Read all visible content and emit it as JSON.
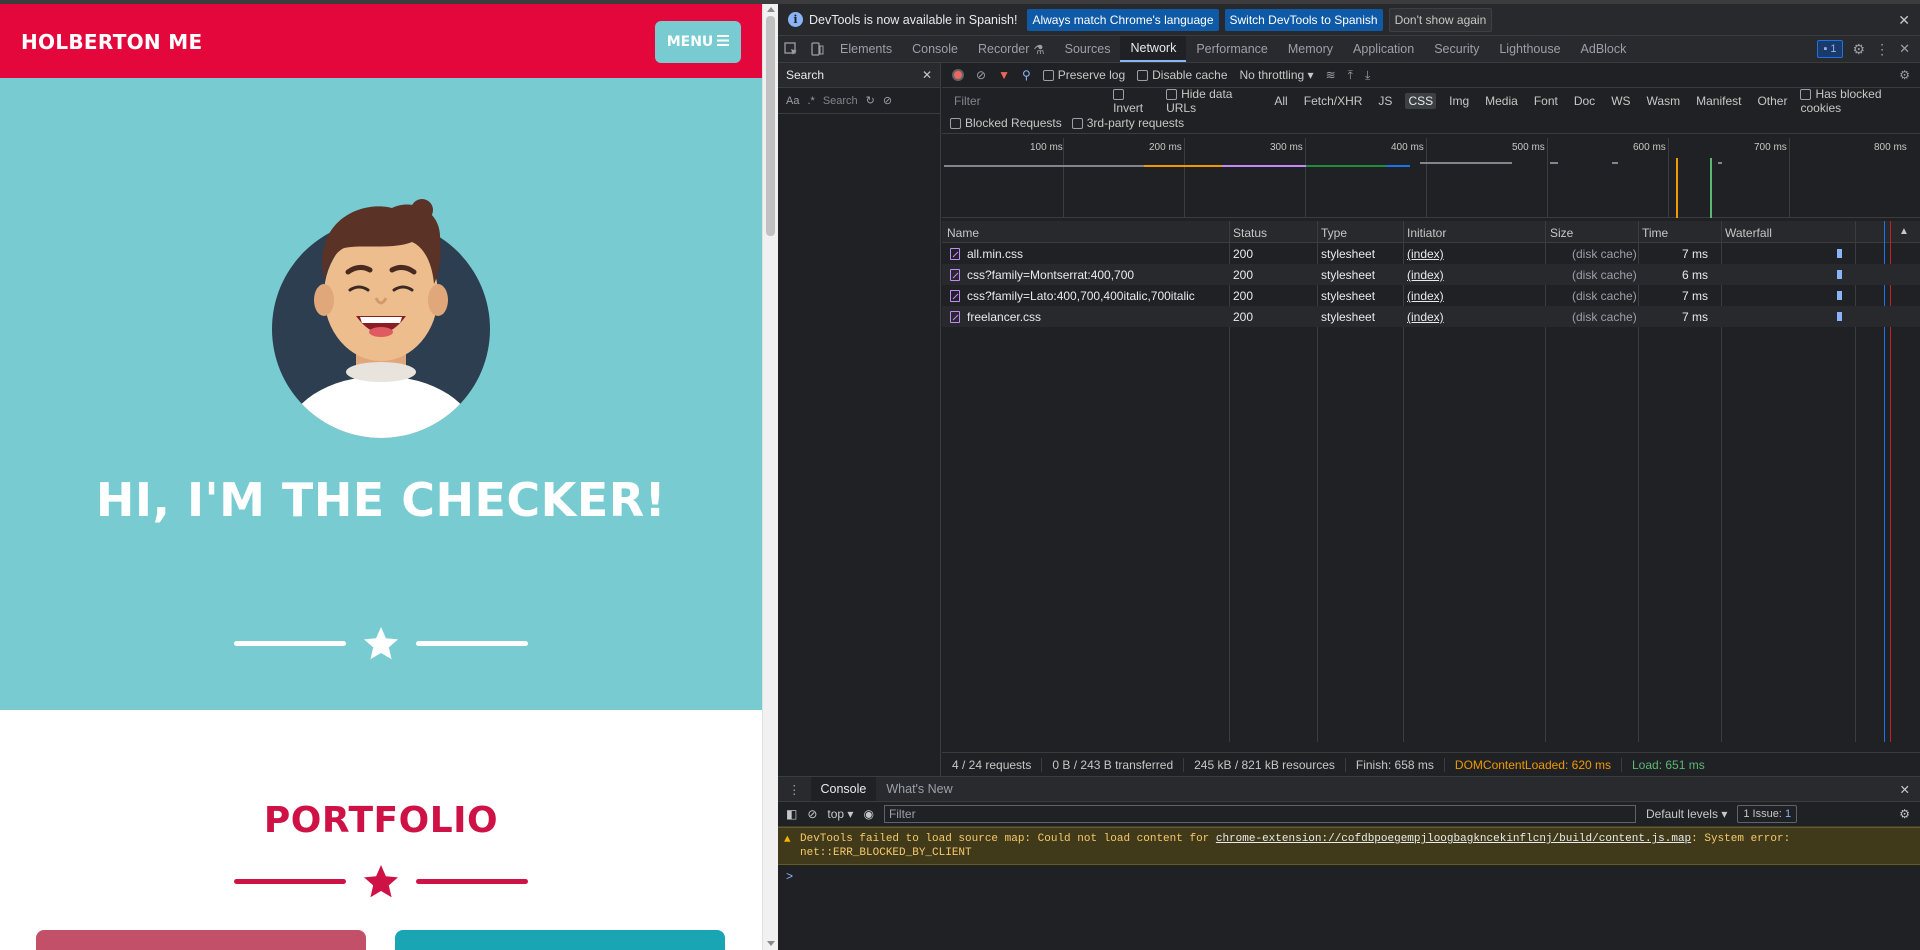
{
  "page": {
    "brand": "HOLBERTON ME",
    "menu_label": "MENU",
    "hero_title": "HI, I'M THE CHECKER!",
    "portfolio_title": "PORTFOLIO",
    "colors": {
      "navbar": "#e3073c",
      "hero": "#78ccd1",
      "accent": "#cf1246",
      "menu_button": "#77cbd1"
    }
  },
  "devtools": {
    "infobar": {
      "message": "DevTools is now available in Spanish!",
      "btn_match": "Always match Chrome's language",
      "btn_switch": "Switch DevTools to Spanish",
      "btn_dismiss": "Don't show again"
    },
    "tabs": [
      "Elements",
      "Console",
      "Recorder",
      "Sources",
      "Network",
      "Performance",
      "Memory",
      "Application",
      "Security",
      "Lighthouse",
      "AdBlock"
    ],
    "active_tab": "Network",
    "issues_count": "1",
    "search_panel": {
      "title": "Search",
      "placeholder": "Search",
      "case_label": "Aa",
      "regex_label": ".*"
    },
    "toolbar": {
      "preserve_log": "Preserve log",
      "disable_cache": "Disable cache",
      "throttling": "No throttling"
    },
    "filter": {
      "placeholder": "Filter",
      "invert": "Invert",
      "hide_data_urls": "Hide data URLs",
      "types": [
        "All",
        "Fetch/XHR",
        "JS",
        "CSS",
        "Img",
        "Media",
        "Font",
        "Doc",
        "WS",
        "Wasm",
        "Manifest",
        "Other"
      ],
      "active_type": "CSS",
      "has_blocked_cookies": "Has blocked cookies",
      "blocked_requests": "Blocked Requests",
      "third_party": "3rd-party requests"
    },
    "timeline_ticks": [
      "100 ms",
      "200 ms",
      "300 ms",
      "400 ms",
      "500 ms",
      "600 ms",
      "700 ms",
      "800 ms"
    ],
    "columns": [
      "Name",
      "Status",
      "Type",
      "Initiator",
      "Size",
      "Time",
      "Waterfall"
    ],
    "requests": [
      {
        "name": "all.min.css",
        "status": "200",
        "type": "stylesheet",
        "initiator": "(index)",
        "size": "(disk cache)",
        "time": "7 ms"
      },
      {
        "name": "css?family=Montserrat:400,700",
        "status": "200",
        "type": "stylesheet",
        "initiator": "(index)",
        "size": "(disk cache)",
        "time": "6 ms"
      },
      {
        "name": "css?family=Lato:400,700,400italic,700italic",
        "status": "200",
        "type": "stylesheet",
        "initiator": "(index)",
        "size": "(disk cache)",
        "time": "7 ms"
      },
      {
        "name": "freelancer.css",
        "status": "200",
        "type": "stylesheet",
        "initiator": "(index)",
        "size": "(disk cache)",
        "time": "7 ms"
      }
    ],
    "summary": {
      "requests": "4 / 24 requests",
      "transferred": "0 B / 243 B transferred",
      "resources": "245 kB / 821 kB resources",
      "finish": "Finish: 658 ms",
      "dcl": "DOMContentLoaded: 620 ms",
      "load": "Load: 651 ms"
    },
    "drawer": {
      "tabs": [
        "Console",
        "What's New"
      ],
      "context": "top",
      "filter_placeholder": "Filter",
      "levels": "Default levels",
      "issues": "1 Issue:",
      "issues_count": "1",
      "warning_prefix": "DevTools failed to load source map: Could not load content for ",
      "warning_url": "chrome-extension://cofdbpoegempjloogbagkncekinflcnj/build/content.js.map",
      "warning_suffix": ": System error: net::ERR_BLOCKED_BY_CLIENT",
      "prompt": ">"
    }
  }
}
